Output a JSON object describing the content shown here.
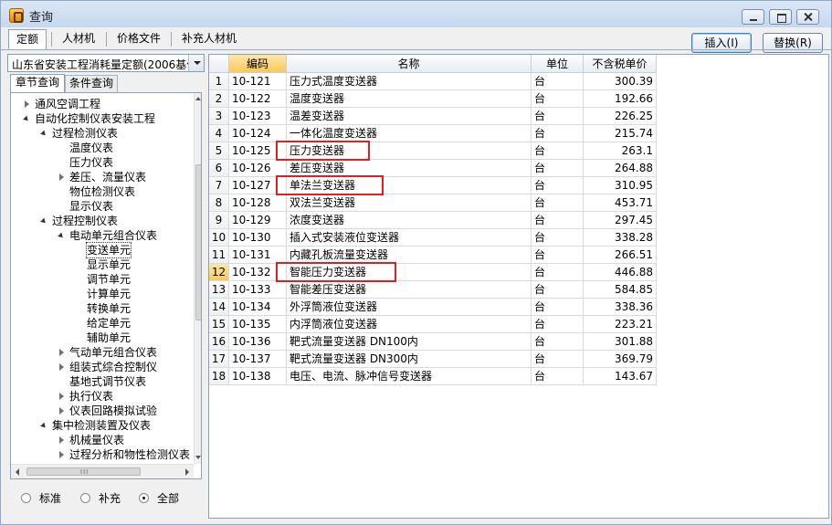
{
  "window": {
    "title": "查询"
  },
  "top_tabs": [
    {
      "label": "定额",
      "active": true
    },
    {
      "label": "人材机",
      "active": false
    },
    {
      "label": "价格文件",
      "active": false
    },
    {
      "label": "补充人材机",
      "active": false
    }
  ],
  "buttons": {
    "insert": "插入(I)",
    "replace": "替换(R)"
  },
  "left": {
    "combo_value": "山东省安装工程消耗量定额(2006基价",
    "tabs": [
      {
        "label": "章节查询",
        "active": true
      },
      {
        "label": "条件查询",
        "active": false
      }
    ],
    "tree": [
      {
        "label": "通风空调工程",
        "level": 0,
        "state": "collapsed"
      },
      {
        "label": "自动化控制仪表安装工程",
        "level": 0,
        "state": "expanded"
      },
      {
        "label": "过程检测仪表",
        "level": 1,
        "state": "expanded"
      },
      {
        "label": "温度仪表",
        "level": 2,
        "state": "leaf"
      },
      {
        "label": "压力仪表",
        "level": 2,
        "state": "leaf"
      },
      {
        "label": "差压、流量仪表",
        "level": 2,
        "state": "collapsed"
      },
      {
        "label": "物位检测仪表",
        "level": 2,
        "state": "leaf"
      },
      {
        "label": "显示仪表",
        "level": 2,
        "state": "leaf"
      },
      {
        "label": "过程控制仪表",
        "level": 1,
        "state": "expanded"
      },
      {
        "label": "电动单元组合仪表",
        "level": 2,
        "state": "expanded"
      },
      {
        "label": "变送单元",
        "level": 3,
        "state": "leaf",
        "selected": true
      },
      {
        "label": "显示单元",
        "level": 3,
        "state": "leaf"
      },
      {
        "label": "调节单元",
        "level": 3,
        "state": "leaf"
      },
      {
        "label": "计算单元",
        "level": 3,
        "state": "leaf"
      },
      {
        "label": "转换单元",
        "level": 3,
        "state": "leaf"
      },
      {
        "label": "给定单元",
        "level": 3,
        "state": "leaf"
      },
      {
        "label": "辅助单元",
        "level": 3,
        "state": "leaf"
      },
      {
        "label": "气动单元组合仪表",
        "level": 2,
        "state": "collapsed"
      },
      {
        "label": "组装式综合控制仪",
        "level": 2,
        "state": "collapsed"
      },
      {
        "label": "基地式调节仪表",
        "level": 2,
        "state": "leaf"
      },
      {
        "label": "执行仪表",
        "level": 2,
        "state": "collapsed"
      },
      {
        "label": "仪表回路模拟试验",
        "level": 2,
        "state": "collapsed"
      },
      {
        "label": "集中检测装置及仪表",
        "level": 1,
        "state": "expanded"
      },
      {
        "label": "机械量仪表",
        "level": 2,
        "state": "collapsed"
      },
      {
        "label": "过程分析和物性检测仪表",
        "level": 2,
        "state": "collapsed"
      }
    ],
    "hscroll_grip": "III",
    "radios": [
      {
        "label": "标准",
        "checked": false
      },
      {
        "label": "补充",
        "checked": false
      },
      {
        "label": "全部",
        "checked": true
      }
    ]
  },
  "table": {
    "headers": {
      "num": "",
      "code": "编码",
      "name": "名称",
      "unit": "单位",
      "price": "不含税单价"
    },
    "rows": [
      {
        "num": "1",
        "code": "10-121",
        "name": "压力式温度变送器",
        "unit": "台",
        "price": "300.39"
      },
      {
        "num": "2",
        "code": "10-122",
        "name": "温度变送器",
        "unit": "台",
        "price": "192.66"
      },
      {
        "num": "3",
        "code": "10-123",
        "name": "温差变送器",
        "unit": "台",
        "price": "226.25"
      },
      {
        "num": "4",
        "code": "10-124",
        "name": "一体化温度变送器",
        "unit": "台",
        "price": "215.74"
      },
      {
        "num": "5",
        "code": "10-125",
        "name": "压力变送器",
        "unit": "台",
        "price": "263.1"
      },
      {
        "num": "6",
        "code": "10-126",
        "name": "差压变送器",
        "unit": "台",
        "price": "264.88"
      },
      {
        "num": "7",
        "code": "10-127",
        "name": "单法兰变送器",
        "unit": "台",
        "price": "310.95"
      },
      {
        "num": "8",
        "code": "10-128",
        "name": "双法兰变送器",
        "unit": "台",
        "price": "453.71"
      },
      {
        "num": "9",
        "code": "10-129",
        "name": "浓度变送器",
        "unit": "台",
        "price": "297.45"
      },
      {
        "num": "10",
        "code": "10-130",
        "name": "插入式安装液位变送器",
        "unit": "台",
        "price": "338.28"
      },
      {
        "num": "11",
        "code": "10-131",
        "name": "内藏孔板流量变送器",
        "unit": "台",
        "price": "266.51"
      },
      {
        "num": "12",
        "code": "10-132",
        "name": "智能压力变送器",
        "unit": "台",
        "price": "446.88",
        "current": true
      },
      {
        "num": "13",
        "code": "10-133",
        "name": "智能差压变送器",
        "unit": "台",
        "price": "584.85"
      },
      {
        "num": "14",
        "code": "10-134",
        "name": "外浮筒液位变送器",
        "unit": "台",
        "price": "338.36"
      },
      {
        "num": "15",
        "code": "10-135",
        "name": "内浮筒液位变送器",
        "unit": "台",
        "price": "223.21"
      },
      {
        "num": "16",
        "code": "10-136",
        "name": "靶式流量变送器 DN100内",
        "unit": "台",
        "price": "301.88"
      },
      {
        "num": "17",
        "code": "10-137",
        "name": "靶式流量变送器 DN300内",
        "unit": "台",
        "price": "369.79"
      },
      {
        "num": "18",
        "code": "10-138",
        "name": "电压、电流、脉冲信号变送器",
        "unit": "台",
        "price": "143.67"
      }
    ],
    "annotated_rows": [
      5,
      7,
      12
    ],
    "annotation_color": "#e02020"
  }
}
